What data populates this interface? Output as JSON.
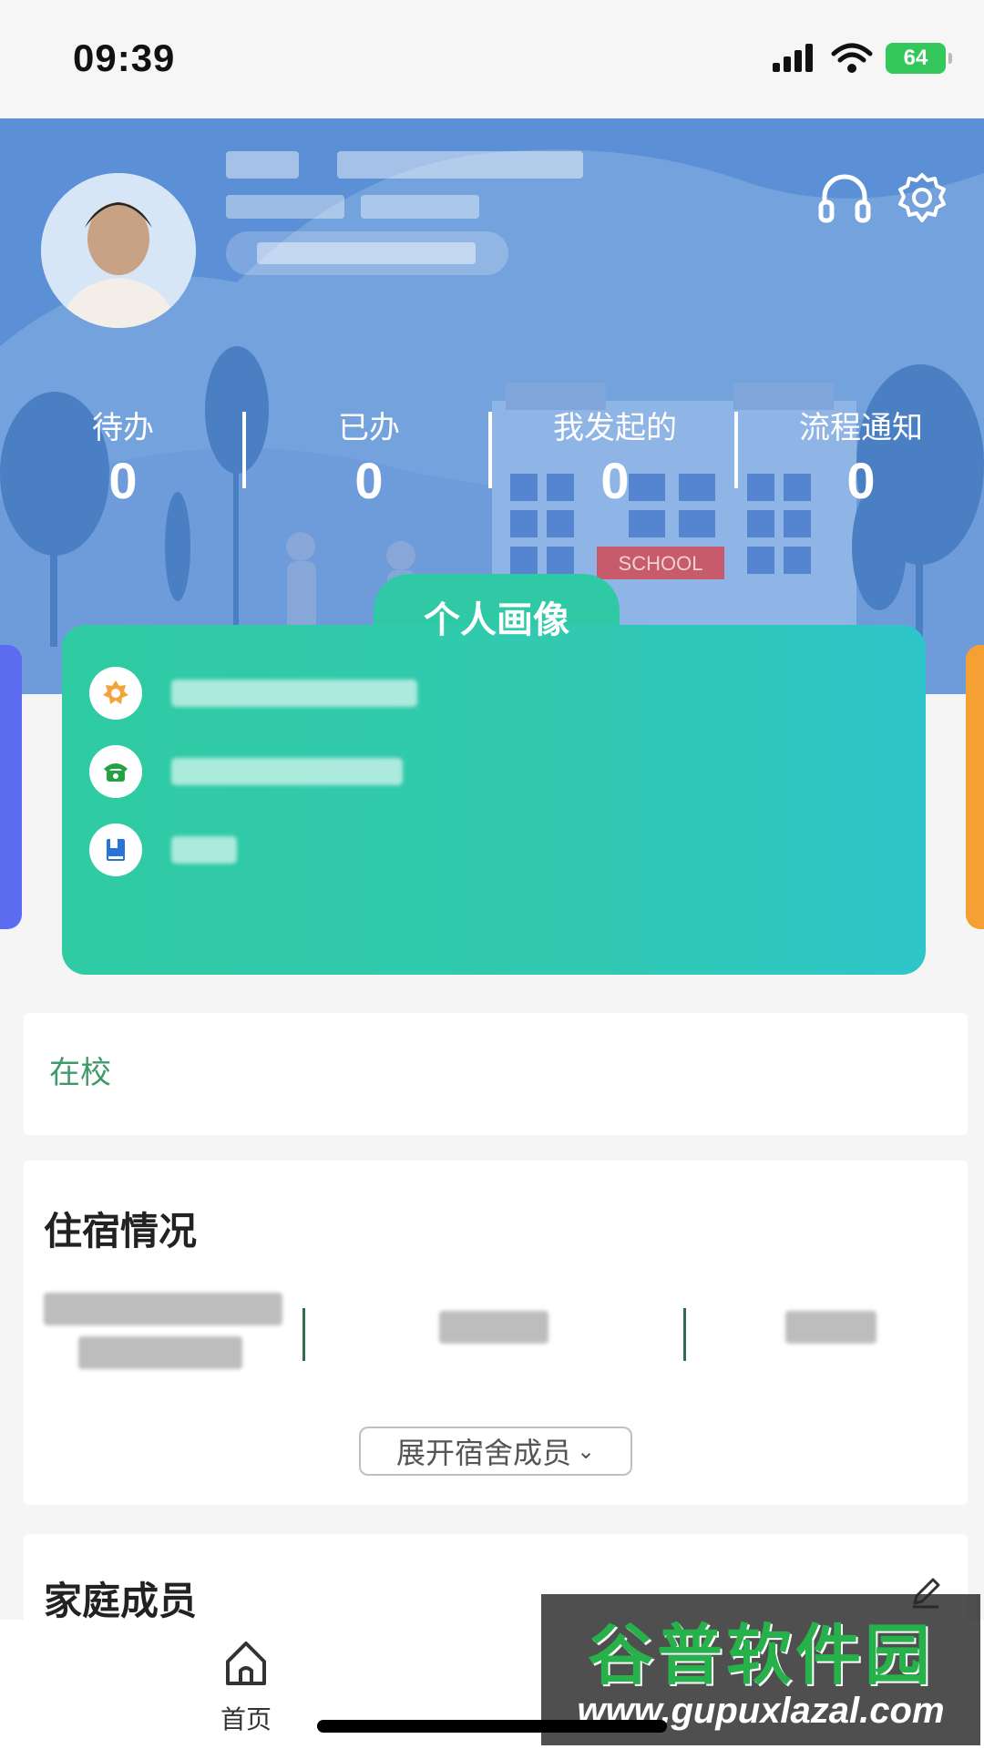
{
  "status_bar": {
    "time": "09:39",
    "battery": "64"
  },
  "header": {
    "stats": [
      {
        "label": "待办",
        "value": "0"
      },
      {
        "label": "已办",
        "value": "0"
      },
      {
        "label": "我发起的",
        "value": "0"
      },
      {
        "label": "流程通知",
        "value": "0"
      }
    ],
    "building_sign": "SCHOOL",
    "icons": [
      "headset-icon",
      "gear-icon"
    ]
  },
  "portrait": {
    "title": "个人画像",
    "rows": [
      {
        "icon": "badge-icon"
      },
      {
        "icon": "phone-icon"
      },
      {
        "icon": "book-icon"
      }
    ]
  },
  "status_card": {
    "label": "在校"
  },
  "dorm": {
    "title": "住宿情况",
    "expand_label": "展开宿舍成员"
  },
  "family": {
    "title": "家庭成员"
  },
  "tabbar": {
    "home_label": "首页"
  },
  "watermark": {
    "brand": "谷普软件园",
    "url": "www.gupuxlazal.com"
  },
  "colors": {
    "header_blue": "#5b8fd6",
    "card_green": "#2fcba3",
    "status_green": "#3e9a68",
    "left_accent": "#5b6cf0",
    "right_accent": "#f5a033"
  }
}
